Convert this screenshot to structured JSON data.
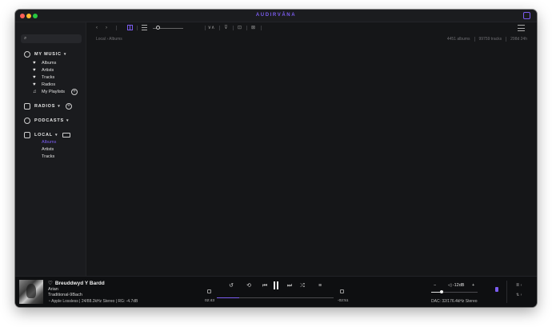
{
  "window": {
    "title": "AUDIRVĀNA"
  },
  "sidebar": {
    "my_music": {
      "label": "MY MUSIC",
      "items": [
        {
          "label": "Albums",
          "icon": "heart-icon"
        },
        {
          "label": "Artists",
          "icon": "heart-icon"
        },
        {
          "label": "Tracks",
          "icon": "heart-icon"
        },
        {
          "label": "Radios",
          "icon": "heart-icon"
        },
        {
          "label": "My Playlists",
          "icon": "playlist-icon"
        }
      ]
    },
    "radios": {
      "label": "RADIOS"
    },
    "podcasts": {
      "label": "PODCASTS"
    },
    "local": {
      "label": "LOCAL",
      "items": [
        {
          "label": "Albums",
          "active": true
        },
        {
          "label": "Artists",
          "active": false
        },
        {
          "label": "Tracks",
          "active": false
        }
      ]
    }
  },
  "toolbar": {
    "back": "‹",
    "forward": "›",
    "sort": "∨∧",
    "filter": "⊽",
    "comment": "⊡",
    "export": "⊠"
  },
  "content": {
    "breadcrumb": "Local › Albums",
    "stats": {
      "albums": "4451 albums",
      "tracks": "99759 tracks",
      "duration": "298d 24h"
    }
  },
  "player": {
    "track_title": "Breuddwyd Y Bardd",
    "favorite_icon": "♡",
    "artist": "Arian",
    "album": "Traditional-9Bach",
    "format": "Apple Lossless | 24/88.2kHz Stereo | RG: -4.7dB",
    "elapsed": "02:43",
    "remaining": "-02:51",
    "progress": 0.19,
    "volume_label": "-12dB",
    "volume_minus": "−",
    "volume_plus": "+",
    "volume_level": 0.22,
    "dac": "DAC: 32/176.4kHz Stereo",
    "controls": {
      "replay": "↺",
      "repeat": "⟲",
      "previous": "⏮",
      "next": "⏭",
      "shuffle": "⤮",
      "queue": "≡"
    }
  },
  "colors": {
    "accent": "#7b5cf0",
    "background": "#151618",
    "sidebar": "#1a1b1e",
    "player": "#0e0f11"
  }
}
